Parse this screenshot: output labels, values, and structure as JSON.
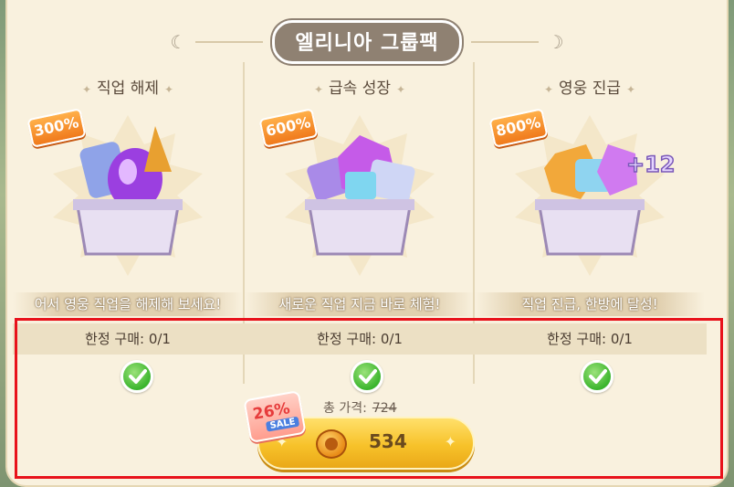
{
  "pack_title": "엘리니아 그룹팩",
  "items": [
    {
      "title": "직업 해제",
      "badge": "300%",
      "desc": "어서 영웅 직업을 해제해 보세요!",
      "limit": "한정 구매: 0/1"
    },
    {
      "title": "급속 성장",
      "badge": "600%",
      "desc": "새로운 직업 지금 바로 체험!",
      "limit": "한정 구매: 0/1"
    },
    {
      "title": "영웅 진급",
      "badge": "800%",
      "desc": "직업 진급, 한방에 달성!",
      "limit": "한정 구매: 0/1"
    }
  ],
  "original_price_label": "총 가격:",
  "original_price": "724",
  "sale_percent": "26%",
  "sale_word": "SALE",
  "price": "534",
  "colors": {
    "panel_bg": "#f9f1de",
    "title_pill": "#8f8172",
    "badge_orange": "#f07a1c",
    "check_green": "#3bb52d",
    "button_gold": "#f7c22a",
    "highlight_red": "#e8121b"
  }
}
